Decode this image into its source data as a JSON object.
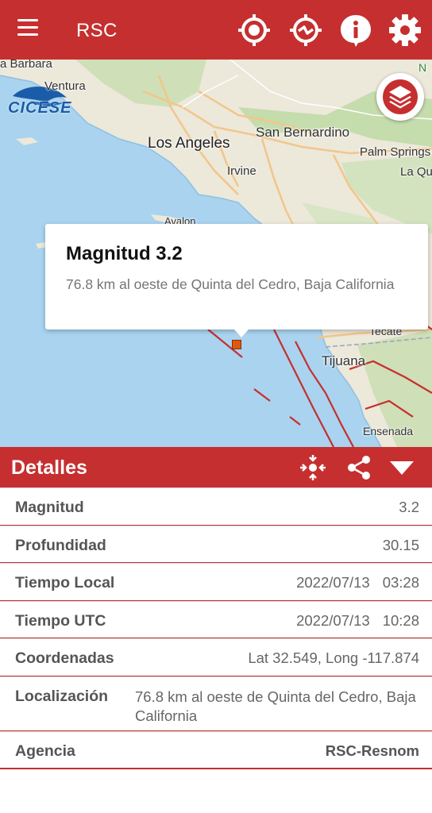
{
  "appbar": {
    "title": "RSC",
    "background": "#c62f2f",
    "icons": [
      "menu-icon",
      "my-location-icon",
      "track-location-icon",
      "info-icon",
      "settings-gear-icon"
    ]
  },
  "map": {
    "logo_text": "CICESE",
    "labels": {
      "santa_barbara": "a Barbara",
      "ventura": "Ventura",
      "los_angeles": "Los Angeles",
      "san_bernardino": "San Bernardino",
      "irvine": "Irvine",
      "palm_springs": "Palm Springs",
      "la_quinta": "La Qu",
      "avalon": "Avalon",
      "tecate": "Tecate",
      "tijuana": "Tijuana",
      "ensenada": "Ensenada",
      "n_edge": "N"
    },
    "layers_icon": "layers-icon",
    "fault_color": "#c62f2f"
  },
  "popup": {
    "title": "Magnitud 3.2",
    "subtitle": "76.8 km al oeste de Quinta del Cedro, Baja California"
  },
  "details": {
    "title": "Detalles",
    "rows": {
      "magnitud": {
        "label": "Magnitud",
        "value": "3.2"
      },
      "profundidad": {
        "label": "Profundidad",
        "value": "30.15"
      },
      "tiempo_local": {
        "label": "Tiempo Local",
        "date": "2022/07/13",
        "time": "03:28"
      },
      "tiempo_utc": {
        "label": "Tiempo UTC",
        "date": "2022/07/13",
        "time": "10:28"
      },
      "coordenadas": {
        "label": "Coordenadas",
        "value": "Lat 32.549, Long -117.874"
      },
      "localizacion": {
        "label": "Localización",
        "value": "76.8 km al oeste de Quinta del Cedro, Baja California"
      },
      "agencia": {
        "label": "Agencia",
        "value": "RSC-Resnom"
      }
    }
  }
}
